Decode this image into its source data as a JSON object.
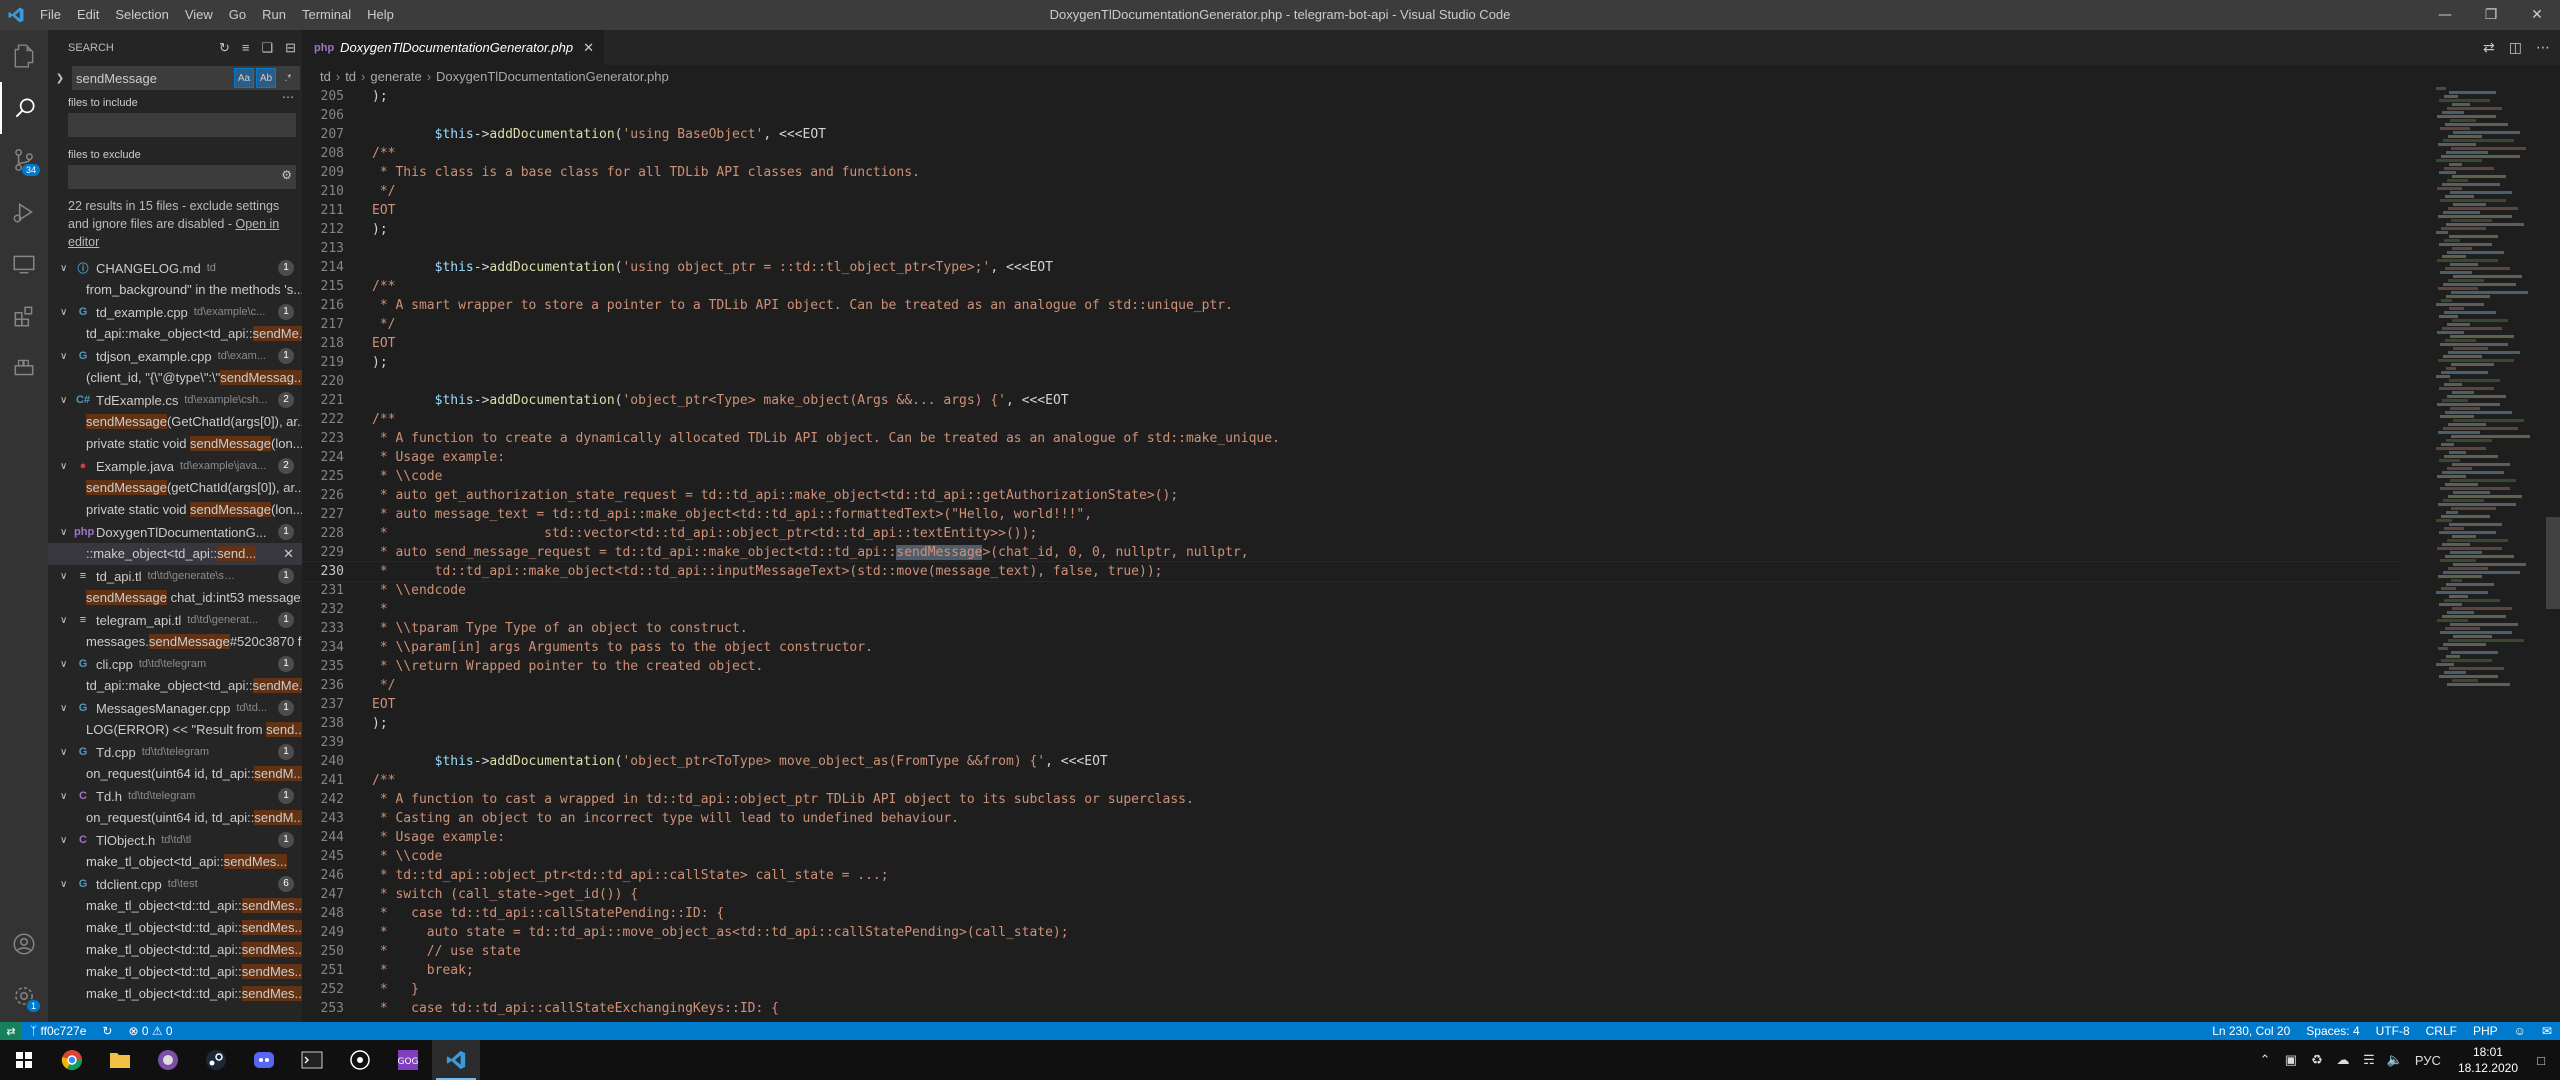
{
  "titlebar": {
    "menu": [
      "File",
      "Edit",
      "Selection",
      "View",
      "Go",
      "Run",
      "Terminal",
      "Help"
    ],
    "title": "DoxygenTlDocumentationGenerator.php - telegram-bot-api - Visual Studio Code"
  },
  "activitybar": {
    "scm_badge": "34",
    "settings_badge": "1"
  },
  "sidebar": {
    "header": "SEARCH",
    "search_value": "sendMessage",
    "toggle_case": "Aa",
    "toggle_word": "Ab",
    "toggle_regex": ".*",
    "include_label": "files to include",
    "exclude_label": "files to exclude",
    "results_text": "22 results in 15 files - exclude settings and ignore files are disabled - ",
    "open_in_editor": "Open in editor",
    "files": [
      {
        "name": "CHANGELOG.md",
        "path": "td",
        "count": "1",
        "icon": "ⓘ",
        "icon_color": "#519aba",
        "matches": [
          {
            "pre": "from_background\" in the methods 's...",
            "hl": "",
            "post": ""
          }
        ]
      },
      {
        "name": "td_example.cpp",
        "path": "td\\example\\c...",
        "count": "1",
        "icon": "G",
        "icon_color": "#519aba",
        "matches": [
          {
            "pre": "td_api::make_object<td_api::",
            "hl": "sendMe...",
            "post": ""
          }
        ]
      },
      {
        "name": "tdjson_example.cpp",
        "path": "td\\exam...",
        "count": "1",
        "icon": "G",
        "icon_color": "#519aba",
        "matches": [
          {
            "pre": "(client_id, \"{\\\"@type\\\":\\\"",
            "hl": "sendMessag...",
            "post": ""
          }
        ]
      },
      {
        "name": "TdExample.cs",
        "path": "td\\example\\csh...",
        "count": "2",
        "icon": "C#",
        "icon_color": "#519aba",
        "matches": [
          {
            "pre": "",
            "hl": "sendMessage",
            "post": "(GetChatId(args[0]), ar..."
          },
          {
            "pre": "private static void ",
            "hl": "sendMessage",
            "post": "(lon..."
          }
        ]
      },
      {
        "name": "Example.java",
        "path": "td\\example\\java...",
        "count": "2",
        "icon": "●",
        "icon_color": "#cc3e44",
        "matches": [
          {
            "pre": "",
            "hl": "sendMessage",
            "post": "(getChatId(args[0]), ar..."
          },
          {
            "pre": "private static void ",
            "hl": "sendMessage",
            "post": "(lon..."
          }
        ]
      },
      {
        "name": "DoxygenTlDocumentationG...",
        "path": "",
        "count": "1",
        "icon": "php",
        "icon_color": "#a074c4",
        "matches": [
          {
            "pre": "::make_object<td_api::",
            "hl": "send...",
            "post": "",
            "selected": true
          }
        ]
      },
      {
        "name": "td_api.tl",
        "path": "td\\td\\generate\\scheme",
        "count": "1",
        "icon": "≡",
        "icon_color": "#cccccc",
        "matches": [
          {
            "pre": "",
            "hl": "sendMessage",
            "post": " chat_id:int53 message..."
          }
        ]
      },
      {
        "name": "telegram_api.tl",
        "path": "td\\td\\generat...",
        "count": "1",
        "icon": "≡",
        "icon_color": "#cccccc",
        "matches": [
          {
            "pre": "messages.",
            "hl": "sendMessage",
            "post": "#520c3870 f..."
          }
        ]
      },
      {
        "name": "cli.cpp",
        "path": "td\\td\\telegram",
        "count": "1",
        "icon": "G",
        "icon_color": "#519aba",
        "matches": [
          {
            "pre": "td_api::make_object<td_api::",
            "hl": "sendMe...",
            "post": ""
          }
        ]
      },
      {
        "name": "MessagesManager.cpp",
        "path": "td\\td...",
        "count": "1",
        "icon": "G",
        "icon_color": "#519aba",
        "matches": [
          {
            "pre": "LOG(ERROR) << \"Result from ",
            "hl": "send...",
            "post": ""
          }
        ]
      },
      {
        "name": "Td.cpp",
        "path": "td\\td\\telegram",
        "count": "1",
        "icon": "G",
        "icon_color": "#519aba",
        "matches": [
          {
            "pre": "on_request(uint64 id, td_api::",
            "hl": "sendM...",
            "post": ""
          }
        ]
      },
      {
        "name": "Td.h",
        "path": "td\\td\\telegram",
        "count": "1",
        "icon": "C",
        "icon_color": "#a074c4",
        "matches": [
          {
            "pre": "on_request(uint64 id, td_api::",
            "hl": "sendM...",
            "post": ""
          }
        ]
      },
      {
        "name": "TlObject.h",
        "path": "td\\td\\tl",
        "count": "1",
        "icon": "C",
        "icon_color": "#a074c4",
        "matches": [
          {
            "pre": "make_tl_object<td_api::",
            "hl": "sendMes...",
            "post": ""
          }
        ]
      },
      {
        "name": "tdclient.cpp",
        "path": "td\\test",
        "count": "6",
        "icon": "G",
        "icon_color": "#519aba",
        "matches": [
          {
            "pre": "make_tl_object<td::td_api::",
            "hl": "sendMes...",
            "post": ""
          },
          {
            "pre": "make_tl_object<td::td_api::",
            "hl": "sendMes...",
            "post": ""
          },
          {
            "pre": "make_tl_object<td::td_api::",
            "hl": "sendMes...",
            "post": ""
          },
          {
            "pre": "make_tl_object<td::td_api::",
            "hl": "sendMes...",
            "post": ""
          },
          {
            "pre": "make_tl_object<td::td_api::",
            "hl": "sendMes...",
            "post": ""
          }
        ]
      }
    ]
  },
  "editor": {
    "tab_label": "DoxygenTlDocumentationGenerator.php",
    "tab_icon": "php",
    "breadcrumb": [
      "td",
      "td",
      "generate",
      "DoxygenTlDocumentationGenerator.php"
    ],
    "current_line": 230,
    "lines": [
      {
        "n": 205,
        "t": [
          [
            "c-plain",
            ");"
          ]
        ]
      },
      {
        "n": 206,
        "t": []
      },
      {
        "n": 207,
        "t": [
          [
            "c-plain",
            "        "
          ],
          [
            "c-var",
            "$this"
          ],
          [
            "c-op",
            "->"
          ],
          [
            "c-fn",
            "addDocumentation"
          ],
          [
            "c-plain",
            "("
          ],
          [
            "c-str",
            "'using BaseObject'"
          ],
          [
            "c-plain",
            ", <<<EOT"
          ]
        ]
      },
      {
        "n": 208,
        "t": [
          [
            "c-cm",
            "/**"
          ]
        ]
      },
      {
        "n": 209,
        "t": [
          [
            "c-cm",
            " * This class is a base class for all TDLib API classes and functions."
          ]
        ]
      },
      {
        "n": 210,
        "t": [
          [
            "c-cm",
            " */"
          ]
        ]
      },
      {
        "n": 211,
        "t": [
          [
            "c-cm",
            "EOT"
          ]
        ]
      },
      {
        "n": 212,
        "t": [
          [
            "c-plain",
            ");"
          ]
        ]
      },
      {
        "n": 213,
        "t": []
      },
      {
        "n": 214,
        "t": [
          [
            "c-plain",
            "        "
          ],
          [
            "c-var",
            "$this"
          ],
          [
            "c-op",
            "->"
          ],
          [
            "c-fn",
            "addDocumentation"
          ],
          [
            "c-plain",
            "("
          ],
          [
            "c-str",
            "'using object_ptr = ::td::tl_object_ptr<Type>;'"
          ],
          [
            "c-plain",
            ", <<<EOT"
          ]
        ]
      },
      {
        "n": 215,
        "t": [
          [
            "c-cm",
            "/**"
          ]
        ]
      },
      {
        "n": 216,
        "t": [
          [
            "c-cm",
            " * A smart wrapper to store a pointer to a TDLib API object. Can be treated as an analogue of std::unique_ptr."
          ]
        ]
      },
      {
        "n": 217,
        "t": [
          [
            "c-cm",
            " */"
          ]
        ]
      },
      {
        "n": 218,
        "t": [
          [
            "c-cm",
            "EOT"
          ]
        ]
      },
      {
        "n": 219,
        "t": [
          [
            "c-plain",
            ");"
          ]
        ]
      },
      {
        "n": 220,
        "t": []
      },
      {
        "n": 221,
        "t": [
          [
            "c-plain",
            "        "
          ],
          [
            "c-var",
            "$this"
          ],
          [
            "c-op",
            "->"
          ],
          [
            "c-fn",
            "addDocumentation"
          ],
          [
            "c-plain",
            "("
          ],
          [
            "c-str",
            "'object_ptr<Type> make_object(Args &&... args) {'"
          ],
          [
            "c-plain",
            ", <<<EOT"
          ]
        ]
      },
      {
        "n": 222,
        "t": [
          [
            "c-cm",
            "/**"
          ]
        ]
      },
      {
        "n": 223,
        "t": [
          [
            "c-cm",
            " * A function to create a dynamically allocated TDLib API object. Can be treated as an analogue of std::make_unique."
          ]
        ]
      },
      {
        "n": 224,
        "t": [
          [
            "c-cm",
            " * Usage example:"
          ]
        ]
      },
      {
        "n": 225,
        "t": [
          [
            "c-cm",
            " * \\\\code"
          ]
        ]
      },
      {
        "n": 226,
        "t": [
          [
            "c-cm",
            " * auto get_authorization_state_request = td::td_api::make_object<td::td_api::getAuthorizationState>();"
          ]
        ]
      },
      {
        "n": 227,
        "t": [
          [
            "c-cm",
            " * auto message_text = td::td_api::make_object<td::td_api::formattedText>(\"Hello, world!!!\","
          ]
        ]
      },
      {
        "n": 228,
        "t": [
          [
            "c-cm",
            " *                    std::vector<td::td_api::object_ptr<td::td_api::textEntity>>());"
          ]
        ]
      },
      {
        "n": 229,
        "t": [
          [
            "c-cm",
            " * auto send_message_request = td::td_api::make_object<td::td_api::"
          ],
          [
            "c-cm c-match",
            "sendMessage"
          ],
          [
            "c-cm",
            ">(chat_id, 0, 0, nullptr, nullptr,"
          ]
        ]
      },
      {
        "n": 230,
        "t": [
          [
            "c-cm",
            " *      td::td_api::make_object<td::td_api::inputMessageText>(std::move(message_text), false, true));"
          ]
        ]
      },
      {
        "n": 231,
        "t": [
          [
            "c-cm",
            " * \\\\endcode"
          ]
        ]
      },
      {
        "n": 232,
        "t": [
          [
            "c-cm",
            " *"
          ]
        ]
      },
      {
        "n": 233,
        "t": [
          [
            "c-cm",
            " * \\\\tparam Type Type of an object to construct."
          ]
        ]
      },
      {
        "n": 234,
        "t": [
          [
            "c-cm",
            " * \\\\param[in] args Arguments to pass to the object constructor."
          ]
        ]
      },
      {
        "n": 235,
        "t": [
          [
            "c-cm",
            " * \\\\return Wrapped pointer to the created object."
          ]
        ]
      },
      {
        "n": 236,
        "t": [
          [
            "c-cm",
            " */"
          ]
        ]
      },
      {
        "n": 237,
        "t": [
          [
            "c-cm",
            "EOT"
          ]
        ]
      },
      {
        "n": 238,
        "t": [
          [
            "c-plain",
            ");"
          ]
        ]
      },
      {
        "n": 239,
        "t": []
      },
      {
        "n": 240,
        "t": [
          [
            "c-plain",
            "        "
          ],
          [
            "c-var",
            "$this"
          ],
          [
            "c-op",
            "->"
          ],
          [
            "c-fn",
            "addDocumentation"
          ],
          [
            "c-plain",
            "("
          ],
          [
            "c-str",
            "'object_ptr<ToType> move_object_as(FromType &&from) {'"
          ],
          [
            "c-plain",
            ", <<<EOT"
          ]
        ]
      },
      {
        "n": 241,
        "t": [
          [
            "c-cm",
            "/**"
          ]
        ]
      },
      {
        "n": 242,
        "t": [
          [
            "c-cm",
            " * A function to cast a wrapped in td::td_api::object_ptr TDLib API object to its subclass or superclass."
          ]
        ]
      },
      {
        "n": 243,
        "t": [
          [
            "c-cm",
            " * Casting an object to an incorrect type will lead to undefined behaviour."
          ]
        ]
      },
      {
        "n": 244,
        "t": [
          [
            "c-cm",
            " * Usage example:"
          ]
        ]
      },
      {
        "n": 245,
        "t": [
          [
            "c-cm",
            " * \\\\code"
          ]
        ]
      },
      {
        "n": 246,
        "t": [
          [
            "c-cm",
            " * td::td_api::object_ptr<td::td_api::callState> call_state = ...;"
          ]
        ]
      },
      {
        "n": 247,
        "t": [
          [
            "c-cm",
            " * switch (call_state->get_id()) {"
          ]
        ]
      },
      {
        "n": 248,
        "t": [
          [
            "c-cm",
            " *   case td::td_api::callStatePending::ID: {"
          ]
        ]
      },
      {
        "n": 249,
        "t": [
          [
            "c-cm",
            " *     auto state = td::td_api::move_object_as<td::td_api::callStatePending>(call_state);"
          ]
        ]
      },
      {
        "n": 250,
        "t": [
          [
            "c-cm",
            " *     // use state"
          ]
        ]
      },
      {
        "n": 251,
        "t": [
          [
            "c-cm",
            " *     break;"
          ]
        ]
      },
      {
        "n": 252,
        "t": [
          [
            "c-cm",
            " *   }"
          ]
        ]
      },
      {
        "n": 253,
        "t": [
          [
            "c-cm",
            " *   case td::td_api::callStateExchangingKeys::ID: {"
          ]
        ]
      }
    ]
  },
  "statusbar": {
    "branch": "ff0c727e",
    "sync": "↻",
    "problems": "⊗ 0 ⚠ 0",
    "position": "Ln 230, Col 20",
    "spaces": "Spaces: 4",
    "encoding": "UTF-8",
    "eol": "CRLF",
    "language": "PHP"
  },
  "taskbar": {
    "lang": "РУС",
    "time": "18:01",
    "date": "18.12.2020"
  },
  "colors": {
    "accent": "#007acc",
    "match_highlight": "#613214"
  }
}
